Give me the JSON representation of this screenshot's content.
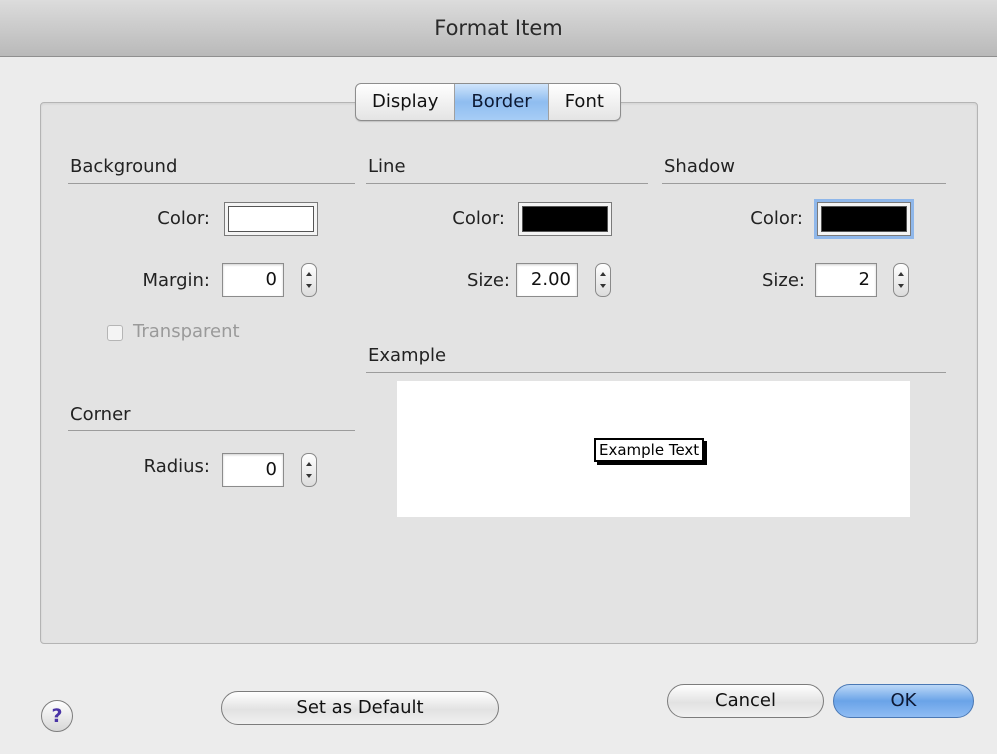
{
  "window": {
    "title": "Format Item"
  },
  "tabs": [
    {
      "label": "Display",
      "active": false
    },
    {
      "label": "Border",
      "active": true
    },
    {
      "label": "Font",
      "active": false
    }
  ],
  "background": {
    "heading": "Background",
    "color_label": "Color:",
    "color_value": "#ffffff",
    "margin_label": "Margin:",
    "margin_value": "0",
    "transparent_label": "Transparent",
    "transparent_checked": false,
    "transparent_enabled": false
  },
  "corner": {
    "heading": "Corner",
    "radius_label": "Radius:",
    "radius_value": "0"
  },
  "line": {
    "heading": "Line",
    "color_label": "Color:",
    "color_value": "#000000",
    "size_label": "Size:",
    "size_value": "2.00"
  },
  "shadow": {
    "heading": "Shadow",
    "color_label": "Color:",
    "color_value": "#000000",
    "size_label": "Size:",
    "size_value": "2"
  },
  "example": {
    "heading": "Example",
    "text": "Example Text"
  },
  "buttons": {
    "help": "?",
    "set_default": "Set as Default",
    "cancel": "Cancel",
    "ok": "OK"
  }
}
